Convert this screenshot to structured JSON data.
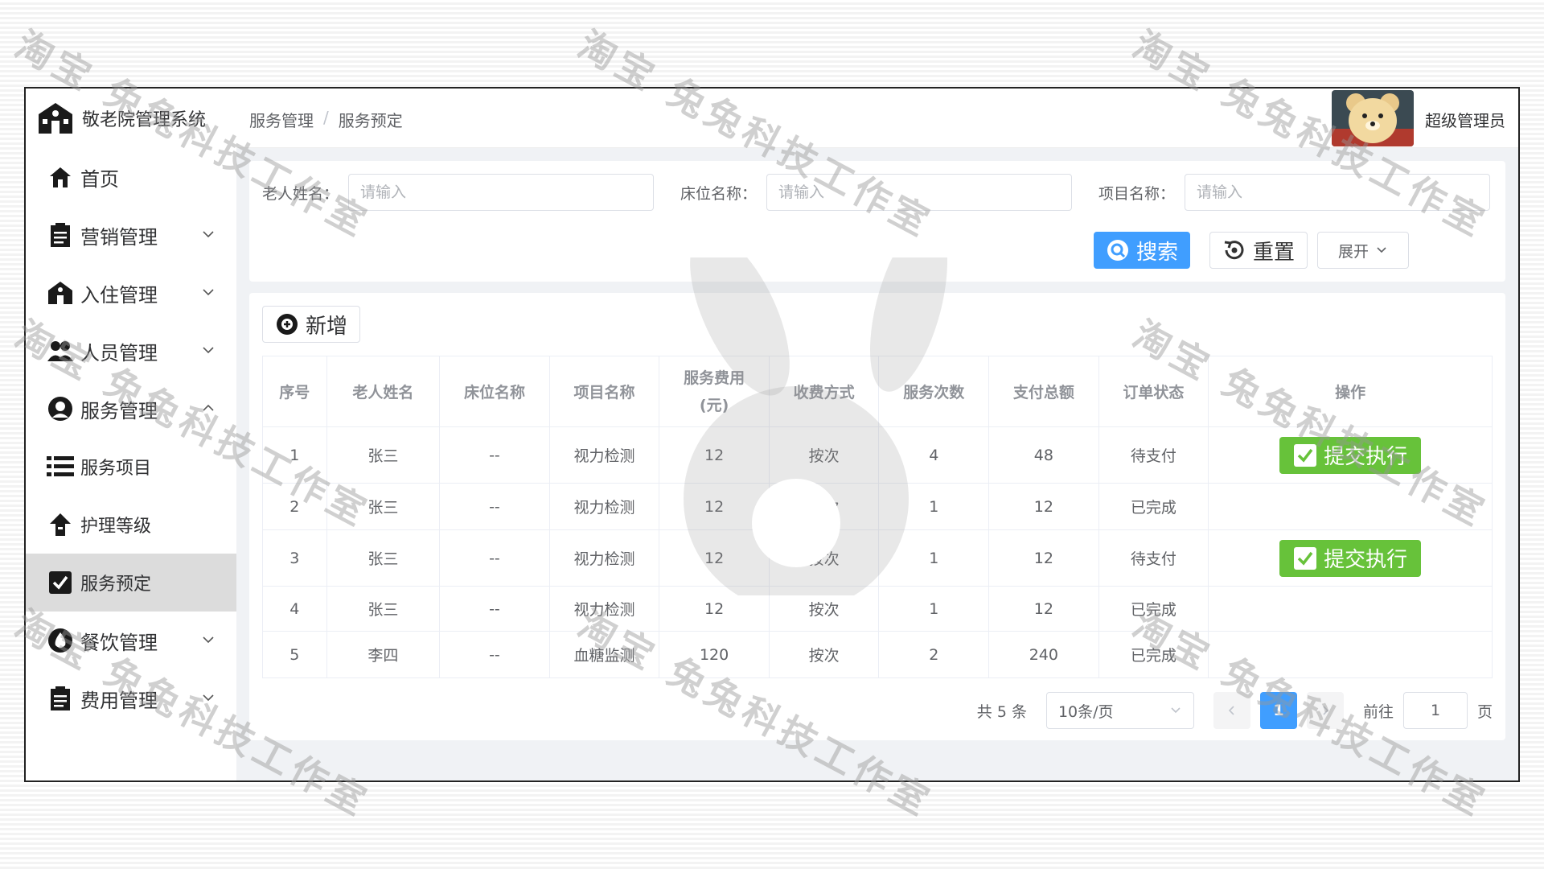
{
  "app": {
    "title": "敬老院管理系统"
  },
  "sidebar": {
    "items": [
      {
        "label": "首页",
        "icon": "home-icon",
        "has_chevron": false
      },
      {
        "label": "营销管理",
        "icon": "clipboard-icon",
        "has_chevron": true
      },
      {
        "label": "入住管理",
        "icon": "building-icon",
        "has_chevron": true
      },
      {
        "label": "人员管理",
        "icon": "users-icon",
        "has_chevron": true
      },
      {
        "label": "服务管理",
        "icon": "service-icon",
        "has_chevron": true,
        "expanded": true
      },
      {
        "label": "服务项目",
        "icon": "list-icon",
        "sub": true
      },
      {
        "label": "护理等级",
        "icon": "level-up-icon",
        "sub": true
      },
      {
        "label": "服务预定",
        "icon": "check-square-icon",
        "sub": true,
        "active": true
      },
      {
        "label": "餐饮管理",
        "icon": "drop-icon",
        "has_chevron": true
      },
      {
        "label": "费用管理",
        "icon": "clipboard-icon",
        "has_chevron": true
      }
    ]
  },
  "header": {
    "breadcrumb": [
      "服务管理",
      "服务预定"
    ],
    "breadcrumb_sep": "/",
    "user_name": "超级管理员"
  },
  "search": {
    "fields": [
      {
        "label": "老人姓名：",
        "placeholder": "请输入"
      },
      {
        "label": "床位名称：",
        "placeholder": "请输入"
      },
      {
        "label": "项目名称：",
        "placeholder": "请输入"
      }
    ],
    "search_label": "搜索",
    "reset_label": "重置",
    "expand_label": "展开"
  },
  "table": {
    "add_label": "新增",
    "columns": [
      "序号",
      "老人姓名",
      "床位名称",
      "项目名称",
      "服务费用(元)",
      "收费方式",
      "服务次数",
      "支付总额",
      "订单状态",
      "操作"
    ],
    "rows": [
      {
        "idx": "1",
        "name": "张三",
        "bed": "--",
        "item": "视力检测",
        "fee": "12",
        "method": "按次",
        "count": "4",
        "total": "48",
        "status": "待支付",
        "action": "提交执行"
      },
      {
        "idx": "2",
        "name": "张三",
        "bed": "--",
        "item": "视力检测",
        "fee": "12",
        "method": "按次",
        "count": "1",
        "total": "12",
        "status": "已完成",
        "action": ""
      },
      {
        "idx": "3",
        "name": "张三",
        "bed": "--",
        "item": "视力检测",
        "fee": "12",
        "method": "按次",
        "count": "1",
        "total": "12",
        "status": "待支付",
        "action": "提交执行"
      },
      {
        "idx": "4",
        "name": "张三",
        "bed": "--",
        "item": "视力检测",
        "fee": "12",
        "method": "按次",
        "count": "1",
        "total": "12",
        "status": "已完成",
        "action": ""
      },
      {
        "idx": "5",
        "name": "李四",
        "bed": "--",
        "item": "血糖监测",
        "fee": "120",
        "method": "按次",
        "count": "2",
        "total": "240",
        "status": "已完成",
        "action": ""
      }
    ]
  },
  "pagination": {
    "total_text": "共 5 条",
    "page_size": "10条/页",
    "current_page": "1",
    "goto_label": "前往",
    "goto_value": "1",
    "page_suffix": "页"
  },
  "watermark": {
    "text": "淘宝 兔兔科技工作室"
  },
  "colors": {
    "primary": "#409eff",
    "success": "#67c23a",
    "active_menu_bg": "#dcdcdc"
  }
}
